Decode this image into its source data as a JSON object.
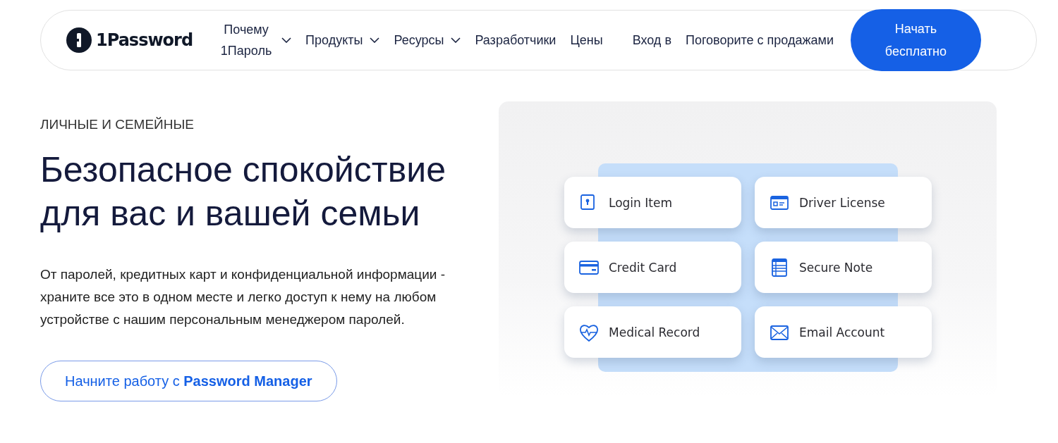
{
  "nav": {
    "logo": "1Password",
    "items": [
      {
        "label": "Почему 1Пароль",
        "has_menu": true
      },
      {
        "label": "Продукты",
        "has_menu": true
      },
      {
        "label": "Ресурсы",
        "has_menu": true
      },
      {
        "label": "Разработчики",
        "has_menu": false
      },
      {
        "label": "Цены",
        "has_menu": false
      }
    ],
    "sign_in": "Вход в",
    "sales": "Поговорите с продажами",
    "cta": "Начать бесплатно"
  },
  "hero": {
    "eyebrow": "ЛИЧНЫЕ И СЕМЕЙНЫЕ",
    "title": "Безопасное спокойствие для вас и вашей семьи",
    "description": "От паролей, кредитных карт и конфиденциальной информации - храните все это в одном месте и легко доступ к нему на любом устройстве с нашим персональным менеджером паролей.",
    "button": "Начните работу с **Password Manager**"
  },
  "items": [
    {
      "label": "Login Item"
    },
    {
      "label": "Driver License"
    },
    {
      "label": "Credit Card"
    },
    {
      "label": "Secure Note"
    },
    {
      "label": "Medical Record"
    },
    {
      "label": "Email Account"
    }
  ]
}
